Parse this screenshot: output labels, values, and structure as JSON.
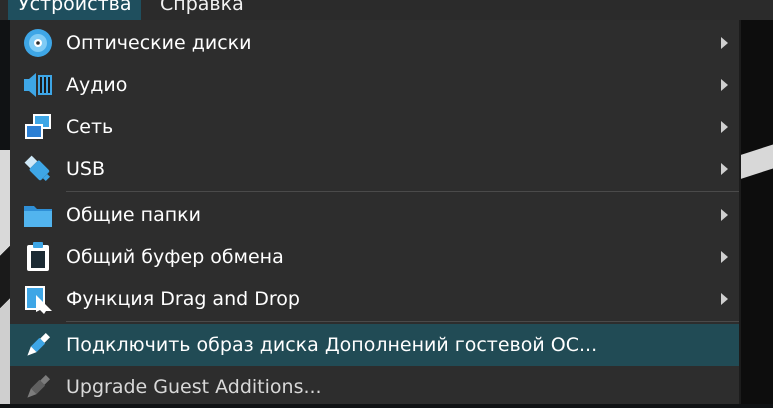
{
  "menubar": {
    "devices_label": "Устройства",
    "help_label": "Справка"
  },
  "menu": {
    "optical": {
      "label": "Оптические диски",
      "icon": "optical-disc-icon"
    },
    "audio": {
      "label": "Аудио",
      "icon": "audio-icon"
    },
    "network": {
      "label": "Сеть",
      "icon": "network-icon"
    },
    "usb": {
      "label": "USB",
      "icon": "usb-icon"
    },
    "shared_folders": {
      "label": "Общие папки",
      "icon": "folder-icon"
    },
    "clipboard": {
      "label": "Общий буфер обмена",
      "icon": "clipboard-icon"
    },
    "drag_drop": {
      "label": "Функция Drag and Drop",
      "icon": "drag-drop-icon"
    },
    "insert_guest": {
      "label": "Подключить образ диска Дополнений гостевой ОС...",
      "icon": "guest-additions-icon"
    },
    "upgrade_guest": {
      "label": "Upgrade Guest Additions...",
      "icon": "guest-additions-disabled-icon"
    }
  },
  "colors": {
    "menu_bg": "#2d2d2d",
    "highlight": "#214b55",
    "accent_blue": "#3ea6e6"
  }
}
